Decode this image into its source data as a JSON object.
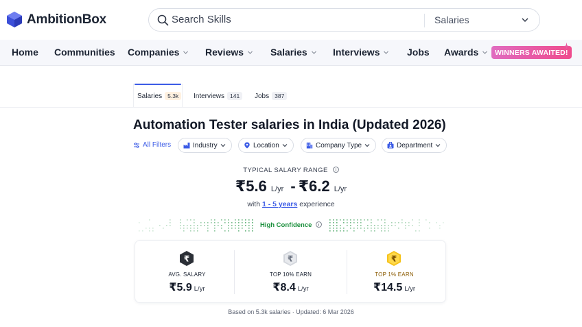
{
  "header": {
    "brand": "AmbitionBox",
    "search_placeholder": "Search Skills",
    "search_scope": "Salaries"
  },
  "nav": {
    "items": [
      {
        "label": "Home",
        "dropdown": false
      },
      {
        "label": "Communities",
        "dropdown": false
      },
      {
        "label": "Companies",
        "dropdown": true
      },
      {
        "label": "Reviews",
        "dropdown": true
      },
      {
        "label": "Salaries",
        "dropdown": true
      },
      {
        "label": "Interviews",
        "dropdown": true
      },
      {
        "label": "Jobs",
        "dropdown": false
      },
      {
        "label": "Awards",
        "dropdown": true
      }
    ],
    "winners_badge": "WINNERS AWAITED!"
  },
  "tabs": [
    {
      "label": "Salaries",
      "count": "5.3k",
      "active": true
    },
    {
      "label": "Interviews",
      "count": "141",
      "active": false
    },
    {
      "label": "Jobs",
      "count": "387",
      "active": false
    }
  ],
  "page": {
    "title": "Automation Tester salaries in India (Updated 2026)"
  },
  "filters": {
    "all_filters": "All Filters",
    "chips": [
      "Industry",
      "Location",
      "Company Type",
      "Department"
    ]
  },
  "range": {
    "label": "TYPICAL SALARY RANGE",
    "currency": "₹",
    "min": "5.6",
    "max": "6.2",
    "unit": "L/yr",
    "exp_prefix": "with",
    "exp_link": "1 - 5 years",
    "exp_suffix": "experience"
  },
  "confidence": {
    "label": "High Confidence",
    "color": "#1a8f3c"
  },
  "stats": [
    {
      "label": "AVG. SALARY",
      "value": "₹5.9",
      "unit": "L/yr",
      "badge_color": "#2b2f36",
      "label_color": "#1c2433"
    },
    {
      "label": "TOP 10% EARN",
      "value": "₹8.4",
      "unit": "L/yr",
      "badge_color": "#c9ccd3",
      "label_color": "#1c2433"
    },
    {
      "label": "TOP 1% EARN",
      "value": "₹14.5",
      "unit": "L/yr",
      "badge_color": "#f5c21b",
      "label_color": "#8a5a00"
    }
  ],
  "footnote": "Based on 5.3k salaries · Updated: 6 Mar 2026",
  "colors": {
    "accent": "#3c5ce6",
    "brand": "#3c4fd8"
  }
}
